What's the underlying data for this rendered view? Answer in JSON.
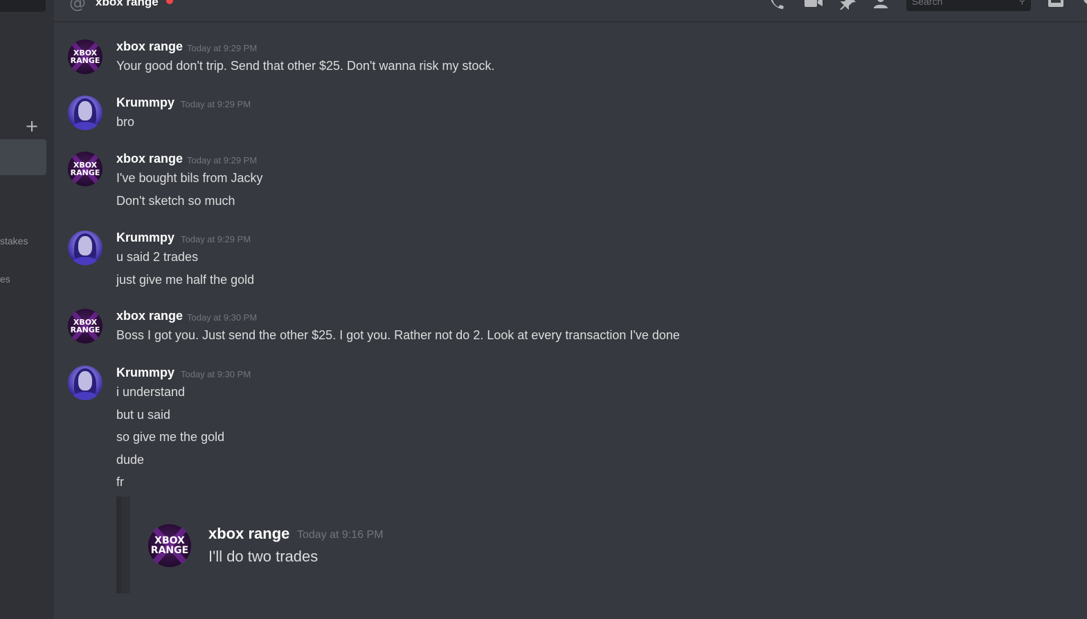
{
  "header": {
    "title": "xbox range",
    "status_color": "#f04747",
    "search_placeholder": "Search",
    "icons": [
      "at-icon",
      "call-icon",
      "video-icon",
      "pin-icon",
      "add-member-icon",
      "search-icon",
      "inbox-icon"
    ]
  },
  "sidebar": {
    "add_icon": "+",
    "partial_items": [
      "stakes",
      "es"
    ]
  },
  "messages": [
    {
      "author": "xbox range",
      "avatar": "xbox-range-avatar",
      "time": "Today at 9:29 PM",
      "lines": [
        "Your good don't trip. Send that other $25. Don't wanna risk my stock."
      ]
    },
    {
      "author": "Krummpy",
      "avatar": "krummpy-avatar",
      "time": "Today at 9:29 PM",
      "lines": [
        "bro"
      ]
    },
    {
      "author": "xbox range",
      "avatar": "xbox-range-avatar",
      "time": "Today at 9:29 PM",
      "lines": [
        "I've bought bils from Jacky",
        "Don't sketch so much"
      ]
    },
    {
      "author": "Krummpy",
      "avatar": "krummpy-avatar",
      "time": "Today at 9:29 PM",
      "lines": [
        "u said 2 trades",
        "just give me half the gold"
      ]
    },
    {
      "author": "xbox range",
      "avatar": "xbox-range-avatar",
      "time": "Today at 9:30 PM",
      "lines": [
        "Boss I got you. Just send the other $25. I got you. Rather not do 2. Look at every transaction I've done"
      ]
    },
    {
      "author": "Krummpy",
      "avatar": "krummpy-avatar",
      "time": "Today at 9:30 PM",
      "lines": [
        "i understand",
        "but u said",
        "so give me the gold",
        "dude",
        "fr"
      ]
    }
  ],
  "avatar_text": {
    "line1": "XBOX",
    "line2": "RANGE"
  },
  "quoted": {
    "author": "xbox range",
    "time": "Today at 9:16 PM",
    "text": "I'll do two trades"
  }
}
